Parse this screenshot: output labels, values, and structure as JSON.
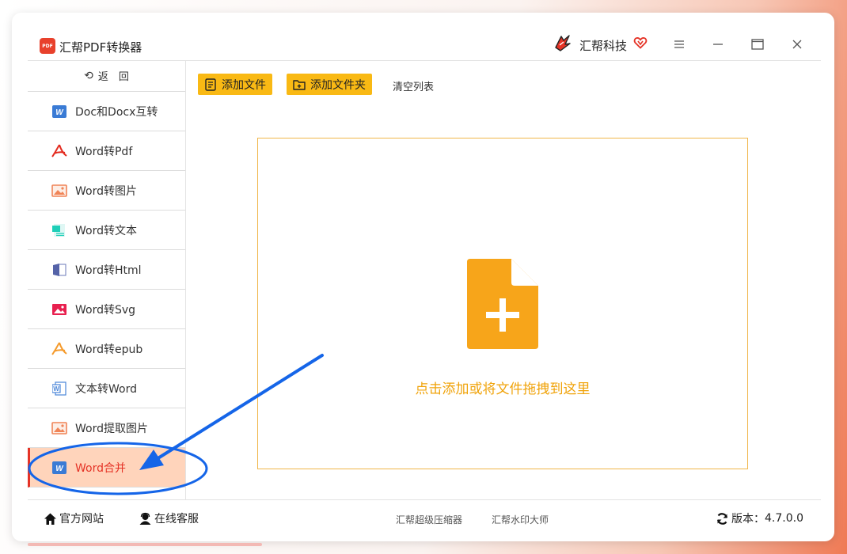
{
  "window": {
    "app_title": "汇帮PDF转换器",
    "app_logo_text": "PDF",
    "brand_name": "汇帮科技"
  },
  "sidebar": {
    "back_label": "返　回",
    "items": [
      {
        "label": "Doc和Docx互转",
        "icon": "word-w-icon"
      },
      {
        "label": "Word转Pdf",
        "icon": "acrobat-icon"
      },
      {
        "label": "Word转图片",
        "icon": "image-icon"
      },
      {
        "label": "Word转文本",
        "icon": "text-doc-icon"
      },
      {
        "label": "Word转Html",
        "icon": "html-icon"
      },
      {
        "label": "Word转Svg",
        "icon": "svg-image-icon"
      },
      {
        "label": "Word转epub",
        "icon": "epub-icon"
      },
      {
        "label": "文本转Word",
        "icon": "word-outline-icon"
      },
      {
        "label": "Word提取图片",
        "icon": "image-icon"
      },
      {
        "label": "Word合并",
        "icon": "word-w-icon",
        "active": true
      }
    ]
  },
  "toolbar": {
    "add_file": "添加文件",
    "add_folder": "添加文件夹",
    "clear_list": "清空列表"
  },
  "dropzone": {
    "hint": "点击添加或将文件拖拽到这里"
  },
  "footer": {
    "website": "官方网站",
    "support": "在线客服",
    "link_compressor": "汇帮超级压缩器",
    "link_watermark": "汇帮水印大师",
    "version_label": "版本：",
    "version": "4.7.0.0"
  },
  "colors": {
    "accent": "#f9b914",
    "active_bg": "#ffd4bb",
    "active_text": "#e53326",
    "annotation": "#1565e8"
  }
}
